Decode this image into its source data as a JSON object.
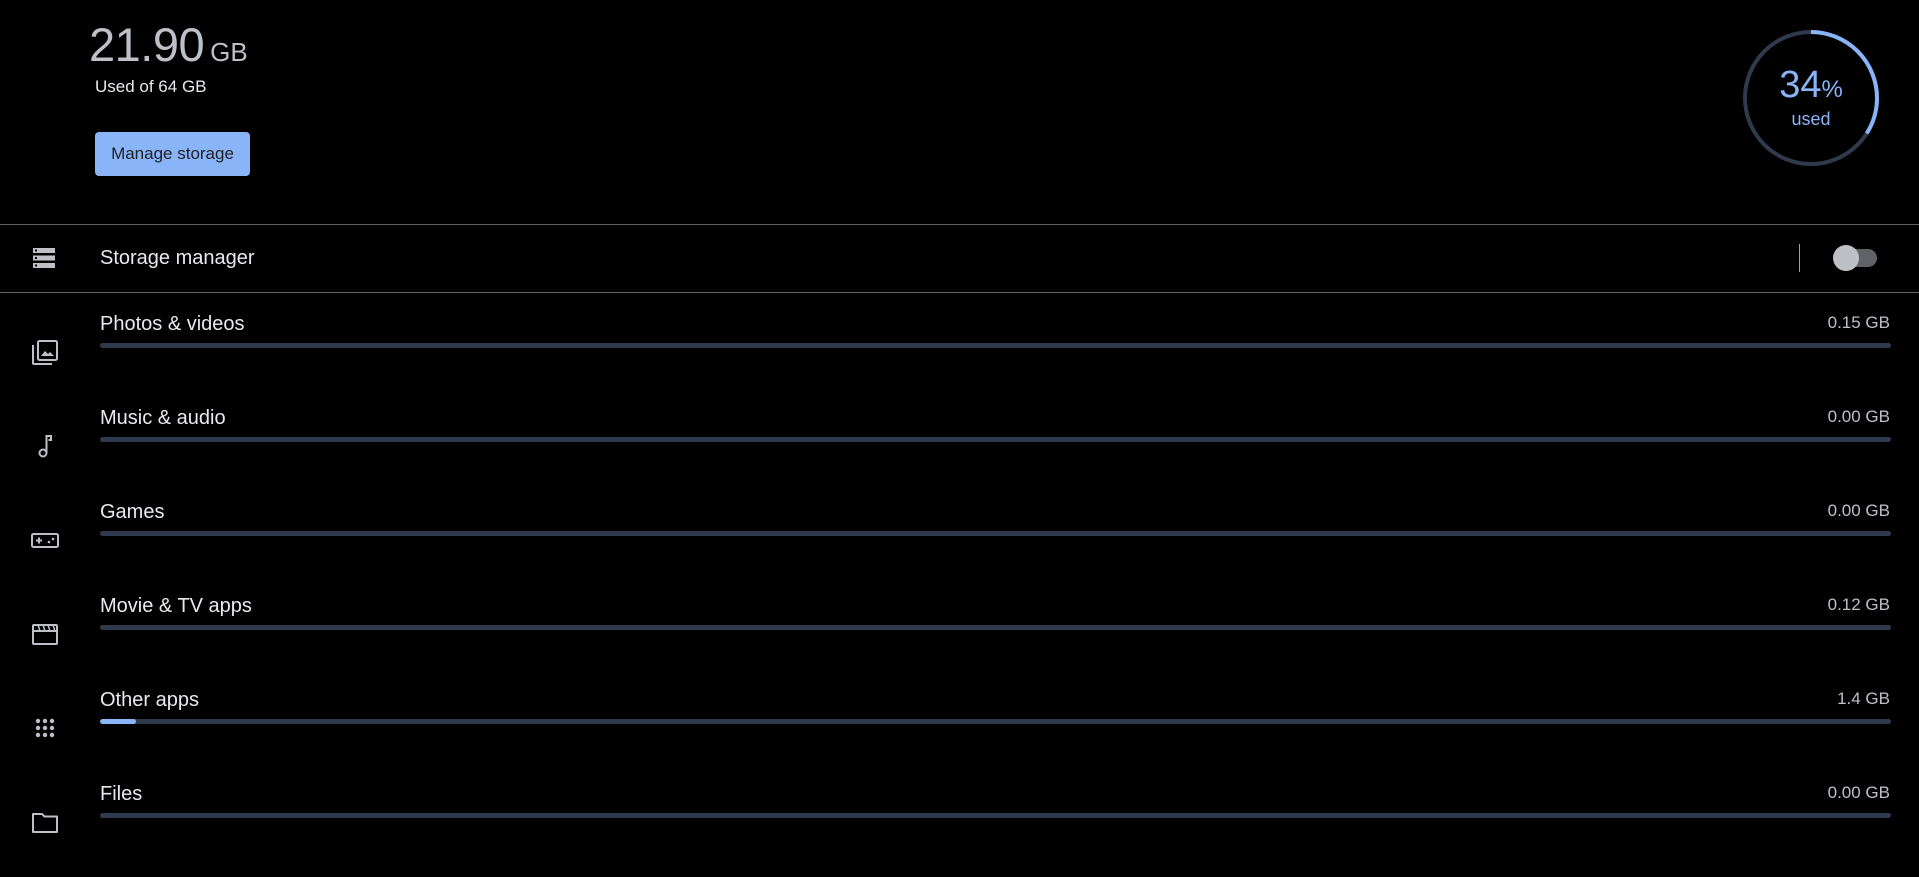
{
  "summary": {
    "used_value": "21.90",
    "used_unit": "GB",
    "used_of": "Used of 64 GB",
    "manage_button": "Manage storage"
  },
  "usage_ring": {
    "percent": "34",
    "percent_sign": "%",
    "label": "used",
    "fraction": 0.34,
    "colors": {
      "fill": "#8ab4f8",
      "track": "#303a4d"
    }
  },
  "storage_manager": {
    "icon": "storage-icon",
    "label": "Storage manager",
    "toggle_on": false
  },
  "categories": [
    {
      "icon": "photo-library-icon",
      "label": "Photos & videos",
      "size": "0.15 GB",
      "fraction": 0.0
    },
    {
      "icon": "music-note-icon",
      "label": "Music & audio",
      "size": "0.00 GB",
      "fraction": 0.0
    },
    {
      "icon": "gamepad-icon",
      "label": "Games",
      "size": "0.00 GB",
      "fraction": 0.0
    },
    {
      "icon": "movie-icon",
      "label": "Movie & TV apps",
      "size": "0.12 GB",
      "fraction": 0.0
    },
    {
      "icon": "apps-grid-icon",
      "label": "Other apps",
      "size": "1.4 GB",
      "fraction": 0.02
    },
    {
      "icon": "folder-icon",
      "label": "Files",
      "size": "0.00 GB",
      "fraction": 0.0
    }
  ],
  "colors": {
    "accent": "#8ab4f8",
    "bar_track": "#303a4d",
    "background": "#000000"
  }
}
